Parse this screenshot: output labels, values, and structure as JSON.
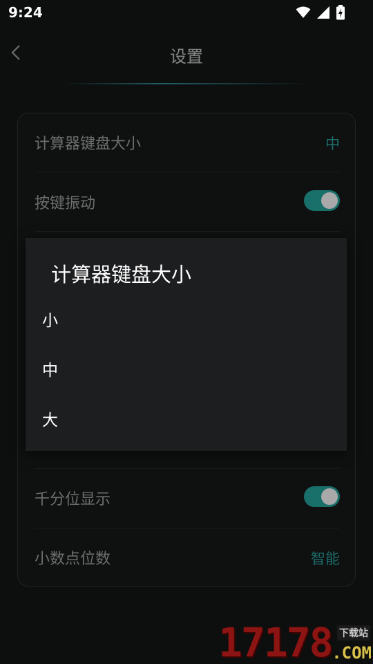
{
  "status_bar": {
    "time": "9:24",
    "icons": [
      "wifi-icon",
      "signal-icon",
      "battery-charging-icon"
    ]
  },
  "header": {
    "back_icon": "chevron-left-icon",
    "title": "设置"
  },
  "settings": {
    "rows": [
      {
        "label": "计算器键盘大小",
        "value": "中",
        "type": "value"
      },
      {
        "label": "按键振动",
        "type": "toggle",
        "on": true
      },
      {
        "label": "千分位显示",
        "type": "toggle",
        "on": true
      },
      {
        "label": "小数点位数",
        "value": "智能",
        "type": "value"
      }
    ]
  },
  "dialog": {
    "title": "计算器键盘大小",
    "options": [
      "小",
      "中",
      "大"
    ]
  },
  "watermark": {
    "number": "17178",
    "top_text": "下载站",
    "domain": ".COM"
  },
  "colors": {
    "accent": "#19706a",
    "background": "#0d0e0e",
    "dialog": "#1d1e20"
  }
}
